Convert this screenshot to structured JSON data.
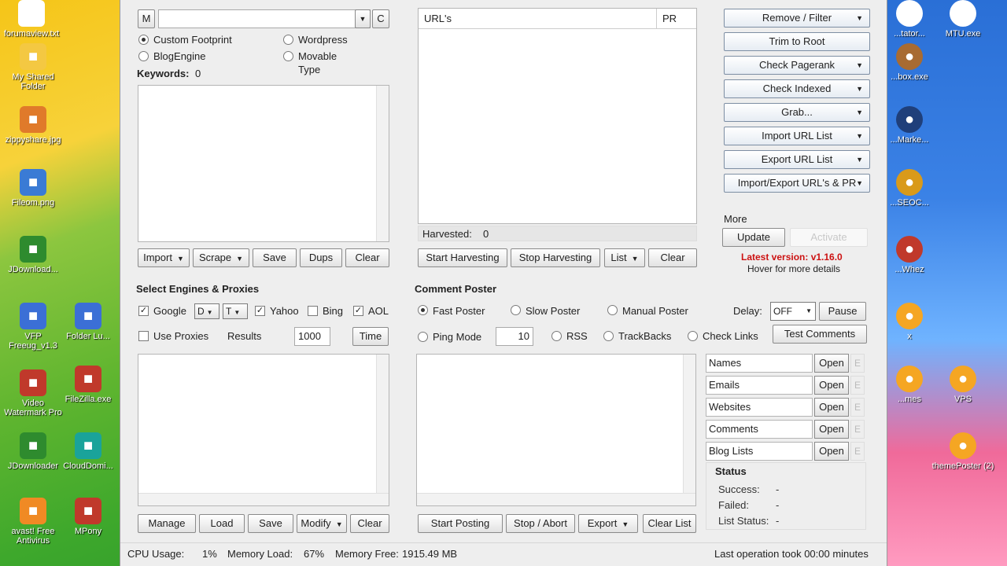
{
  "desktop_left": [
    {
      "label": "forumaview.txt",
      "color": "#ffffff"
    },
    {
      "label": "My Shared Folder",
      "color": "#f4c842"
    },
    {
      "label": "zippyshare.jpg",
      "color": "#e07a2a"
    },
    {
      "label": "Fileom.png",
      "color": "#3a7bd5"
    },
    {
      "label": "JDownload...",
      "color": "#2e8b2e"
    },
    {
      "label": "VFP Freeug_v1.3",
      "color": "#3b6fd6"
    },
    {
      "label": "Folder Lu...",
      "color": "#3b6fd6"
    },
    {
      "label": "Video Watermark Pro",
      "color": "#c0392b"
    },
    {
      "label": "FileZilla.exe",
      "color": "#c0392b"
    },
    {
      "label": "JDownloader",
      "color": "#2e8b2e"
    },
    {
      "label": "CloudDomi...",
      "color": "#1aa39a"
    },
    {
      "label": "avast! Free Antivirus",
      "color": "#f08a24"
    },
    {
      "label": "MPony",
      "color": "#c0392b"
    }
  ],
  "desktop_right": [
    {
      "label": "...tator...",
      "color": "#ffffff"
    },
    {
      "label": "MTU.exe",
      "color": "#ffffff"
    },
    {
      "label": "...box.exe",
      "color": "#a86b32"
    },
    {
      "label": "...Marke...",
      "color": "#1f3f7a"
    },
    {
      "label": "...SEOC...",
      "color": "#d99a1a"
    },
    {
      "label": "...Whez",
      "color": "#c0392b"
    },
    {
      "label": "x",
      "color": "#f5a623"
    },
    {
      "label": "...mes",
      "color": "#f5a623"
    },
    {
      "label": "VPS",
      "color": "#f5a623"
    },
    {
      "label": "themePoster (2)",
      "color": "#f5a623"
    }
  ],
  "harvester": {
    "m_label": "M",
    "c_label": "C",
    "footprint_value": "",
    "radio_custom": "Custom Footprint",
    "radio_wordpress": "Wordpress",
    "radio_blogengine": "BlogEngine",
    "radio_movable": "Movable",
    "radio_movable_2": "Type",
    "keywords_label": "Keywords:",
    "keywords_count": "0",
    "buttons": {
      "import": "Import",
      "scrape": "Scrape",
      "save": "Save",
      "dups": "Dups",
      "clear": "Clear"
    }
  },
  "urls": {
    "col_urls": "URL's",
    "col_pr": "PR",
    "harvested_label": "Harvested:",
    "harvested_count": "0",
    "buttons": {
      "start": "Start Harvesting",
      "stop": "Stop Harvesting",
      "list": "List",
      "clear": "Clear"
    }
  },
  "manage_lists": {
    "buttons": [
      "Remove / Filter",
      "Trim to Root",
      "Check Pagerank",
      "Check Indexed",
      "Grab...",
      "Import URL List",
      "Export URL List",
      "Import/Export URL's & PR"
    ],
    "has_arrow": [
      true,
      false,
      true,
      true,
      true,
      true,
      true,
      true
    ],
    "more_label": "More",
    "update": "Update",
    "activate": "Activate",
    "latest_version": "Latest version: v1.16.0",
    "hover": "Hover for more details",
    "accent_red": "#cc1111"
  },
  "engines": {
    "title": "Select Engines & Proxies",
    "google": "Google",
    "google_d": "D",
    "google_t": "T",
    "yahoo": "Yahoo",
    "bing": "Bing",
    "aol": "AOL",
    "use_proxies": "Use Proxies",
    "results_label": "Results",
    "results_value": "1000",
    "time": "Time",
    "buttons": {
      "manage": "Manage",
      "load": "Load",
      "save": "Save",
      "modify": "Modify",
      "clear": "Clear"
    }
  },
  "poster": {
    "title": "Comment Poster",
    "fast": "Fast Poster",
    "slow": "Slow Poster",
    "manual": "Manual Poster",
    "delay_label": "Delay:",
    "delay_value": "OFF",
    "pause": "Pause",
    "ping": "Ping Mode",
    "ping_value": "10",
    "rss": "RSS",
    "trackbacks": "TrackBacks",
    "check_links": "Check Links",
    "test_comments": "Test Comments",
    "fields": [
      "Names",
      "Emails",
      "Websites",
      "Comments",
      "Blog Lists"
    ],
    "open": "Open",
    "e": "E",
    "status_title": "Status",
    "success_label": "Success:",
    "success_value": "-",
    "failed_label": "Failed:",
    "failed_value": "-",
    "liststatus_label": "List Status:",
    "liststatus_value": "-",
    "buttons": {
      "start": "Start Posting",
      "stop": "Stop / Abort",
      "export": "Export",
      "clear": "Clear List"
    }
  },
  "statusbar": {
    "cpu_label": "CPU Usage:",
    "cpu_value": "1%",
    "mem_label": "Memory Load:",
    "mem_value": "67%",
    "free_label": "Memory Free:",
    "free_value": "1915.49 MB",
    "last_op": "Last operation took 00:00 minutes"
  }
}
